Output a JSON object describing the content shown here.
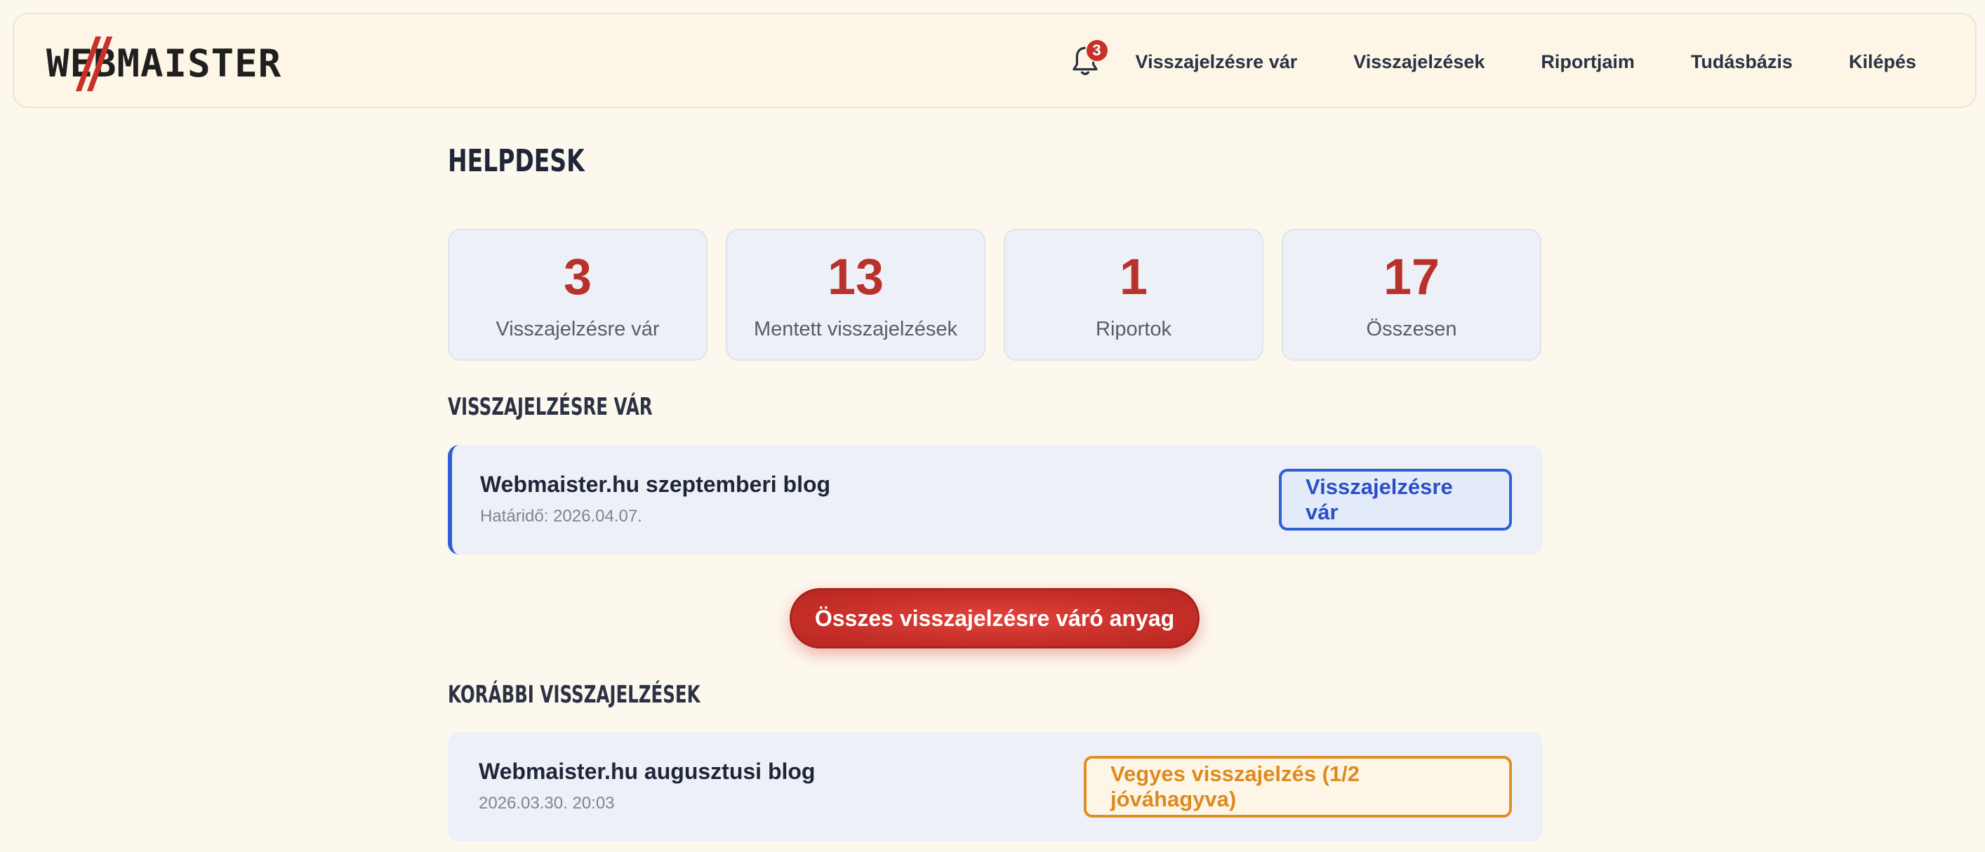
{
  "header": {
    "logo_text": "WEBMAISTER",
    "notification_count": "3",
    "nav": [
      "Visszajelzésre vár",
      "Visszajelzések",
      "Riportjaim",
      "Tudásbázis",
      "Kilépés"
    ]
  },
  "page": {
    "title": "HELPDESK"
  },
  "stats": [
    {
      "value": "3",
      "label": "Visszajelzésre vár"
    },
    {
      "value": "13",
      "label": "Mentett visszajelzések"
    },
    {
      "value": "1",
      "label": "Riportok"
    },
    {
      "value": "17",
      "label": "Összesen"
    }
  ],
  "pending": {
    "section_title": "VISSZAJELZÉSRE VÁR",
    "items": [
      {
        "title": "Webmaister.hu szeptemberi blog",
        "subtitle": "Határidő: 2026.04.07.",
        "status": "Visszajelzésre vár"
      }
    ],
    "all_button": "Összes visszajelzésre váró anyag"
  },
  "previous": {
    "section_title": "KORÁBBI VISSZAJELZÉSEK",
    "items": [
      {
        "title": "Webmaister.hu augusztusi blog",
        "subtitle": "2026.03.30. 20:03",
        "status": "Vegyes visszajelzés (1/2 jóváhagyva)"
      }
    ]
  },
  "colors": {
    "accent_red": "#c8302a",
    "accent_blue": "#2f5fd6",
    "accent_orange": "#df8f28",
    "background": "#fdf8ee"
  }
}
